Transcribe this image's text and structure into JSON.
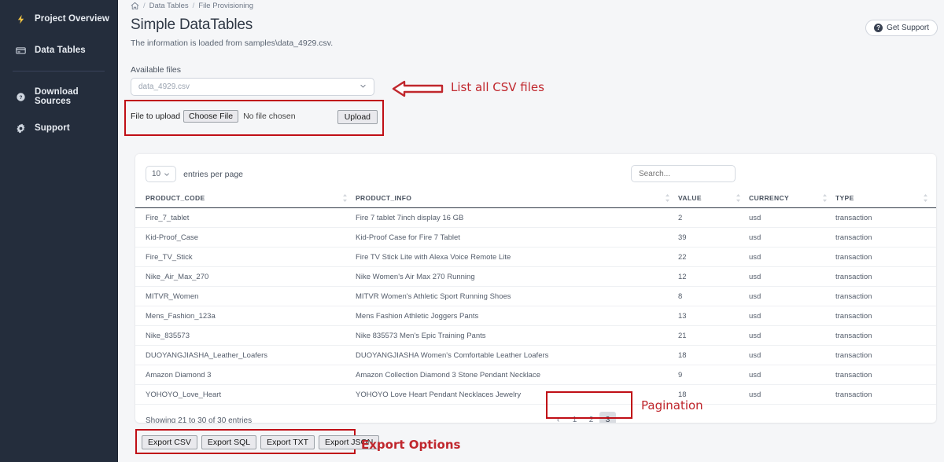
{
  "sidebar": {
    "items": [
      {
        "label": "Project Overview",
        "icon": "bolt-icon"
      },
      {
        "label": "Data Tables",
        "icon": "table-icon"
      },
      {
        "label": "Download Sources",
        "icon": "question-circle-icon"
      },
      {
        "label": "Support",
        "icon": "gear-icon"
      }
    ]
  },
  "header": {
    "breadcrumb": [
      "Data Tables",
      "File Provisioning"
    ],
    "home_icon": "home-icon",
    "title": "Simple DataTables",
    "subtitle": "The information is loaded from samples\\data_4929.csv.",
    "support_button": "Get Support",
    "support_icon": "question-circle-icon"
  },
  "files": {
    "label": "Available files",
    "selected": "data_4929.csv",
    "chevron_icon": "chevron-down-icon",
    "upload_label": "File to upload",
    "choose_file_label": "Choose File",
    "no_file_text": "No file chosen",
    "upload_button": "Upload"
  },
  "annotations": {
    "csv_list": "List all CSV files",
    "pagination": "Pagination",
    "export_options": "Export Options",
    "color": "#c0272d",
    "arrow_icon": "left-arrow-annotation"
  },
  "table": {
    "per_page_value": "10",
    "per_page_label": "entries per page",
    "search_placeholder": "Search...",
    "columns": [
      "PRODUCT_CODE",
      "PRODUCT_INFO",
      "VALUE",
      "CURRENCY",
      "TYPE"
    ],
    "sort_icon": "sort-updown-icon",
    "rows": [
      [
        "Fire_7_tablet",
        "Fire 7 tablet 7inch display 16 GB",
        "2",
        "usd",
        "transaction"
      ],
      [
        "Kid-Proof_Case",
        "Kid-Proof Case for Fire 7 Tablet",
        "39",
        "usd",
        "transaction"
      ],
      [
        "Fire_TV_Stick",
        "Fire TV Stick Lite with Alexa Voice Remote Lite",
        "22",
        "usd",
        "transaction"
      ],
      [
        "Nike_Air_Max_270",
        "Nike Women's Air Max 270 Running",
        "12",
        "usd",
        "transaction"
      ],
      [
        "MITVR_Women",
        "MITVR Women's Athletic Sport Running Shoes",
        "8",
        "usd",
        "transaction"
      ],
      [
        "Mens_Fashion_123a",
        "Mens Fashion Athletic Joggers Pants",
        "13",
        "usd",
        "transaction"
      ],
      [
        "Nike_835573",
        "Nike 835573 Men's Epic Training Pants",
        "21",
        "usd",
        "transaction"
      ],
      [
        "DUOYANGJIASHA_Leather_Loafers",
        "DUOYANGJIASHA Women's Comfortable Leather Loafers",
        "18",
        "usd",
        "transaction"
      ],
      [
        "Amazon Diamond 3",
        "Amazon Collection Diamond 3 Stone Pendant Necklace",
        "9",
        "usd",
        "transaction"
      ],
      [
        "YOHOYO_Love_Heart",
        "YOHOYO Love Heart Pendant Necklaces Jewelry",
        "18",
        "usd",
        "transaction"
      ]
    ],
    "showing": "Showing 21 to 30 of 30 entries",
    "pagination": {
      "prev": "‹",
      "pages": [
        "1",
        "2",
        "3"
      ],
      "active": "3"
    }
  },
  "export": {
    "buttons": [
      "Export CSV",
      "Export SQL",
      "Export TXT",
      "Export JSON"
    ]
  }
}
